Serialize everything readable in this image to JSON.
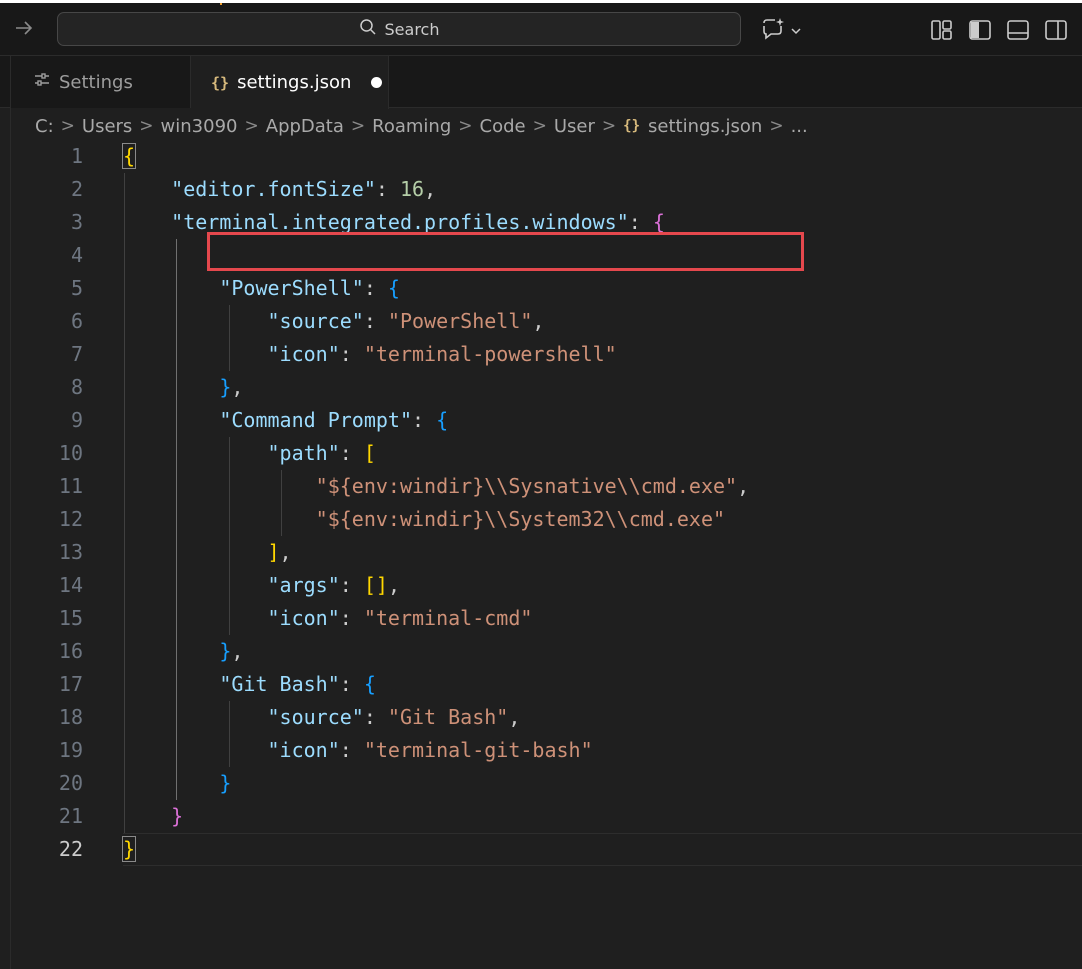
{
  "search": {
    "label": "Search"
  },
  "tabs": [
    {
      "label": "Settings",
      "icon": "settings-sliders-icon"
    },
    {
      "label": "settings.json",
      "icon": "json-braces-icon",
      "dirty": true
    }
  ],
  "breadcrumb": [
    "C:",
    "Users",
    "win3090",
    "AppData",
    "Roaming",
    "Code",
    "User",
    "settings.json",
    "..."
  ],
  "editor": {
    "active_line": "22",
    "line_numbers": [
      "1",
      "2",
      "3",
      "4",
      "5",
      "6",
      "7",
      "8",
      "9",
      "10",
      "11",
      "12",
      "13",
      "14",
      "15",
      "16",
      "17",
      "18",
      "19",
      "20",
      "21",
      "22"
    ],
    "lines": [
      [
        [
          "{",
          "b1"
        ]
      ],
      [
        [
          "    ",
          "p"
        ],
        [
          "\"editor.fontSize\"",
          "k"
        ],
        [
          ": ",
          "p"
        ],
        [
          "16",
          "n"
        ],
        [
          ",",
          "p"
        ]
      ],
      [
        [
          "    ",
          "p"
        ],
        [
          "\"terminal.integrated.profiles.windows\"",
          "k"
        ],
        [
          ": ",
          "p"
        ],
        [
          "{",
          "b2"
        ]
      ],
      [],
      [
        [
          "        ",
          "p"
        ],
        [
          "\"PowerShell\"",
          "k"
        ],
        [
          ": ",
          "p"
        ],
        [
          "{",
          "b3"
        ]
      ],
      [
        [
          "            ",
          "p"
        ],
        [
          "\"source\"",
          "k"
        ],
        [
          ": ",
          "p"
        ],
        [
          "\"PowerShell\"",
          "s"
        ],
        [
          ",",
          "p"
        ]
      ],
      [
        [
          "            ",
          "p"
        ],
        [
          "\"icon\"",
          "k"
        ],
        [
          ": ",
          "p"
        ],
        [
          "\"terminal-powershell\"",
          "s"
        ]
      ],
      [
        [
          "        ",
          "p"
        ],
        [
          "}",
          "b3"
        ],
        [
          ",",
          "p"
        ]
      ],
      [
        [
          "        ",
          "p"
        ],
        [
          "\"Command Prompt\"",
          "k"
        ],
        [
          ": ",
          "p"
        ],
        [
          "{",
          "b3"
        ]
      ],
      [
        [
          "            ",
          "p"
        ],
        [
          "\"path\"",
          "k"
        ],
        [
          ": ",
          "p"
        ],
        [
          "[",
          "b1"
        ]
      ],
      [
        [
          "                ",
          "p"
        ],
        [
          "\"${env:windir}\\\\Sysnative\\\\cmd.exe\"",
          "s"
        ],
        [
          ",",
          "p"
        ]
      ],
      [
        [
          "                ",
          "p"
        ],
        [
          "\"${env:windir}\\\\System32\\\\cmd.exe\"",
          "s"
        ]
      ],
      [
        [
          "            ",
          "p"
        ],
        [
          "]",
          "b1"
        ],
        [
          ",",
          "p"
        ]
      ],
      [
        [
          "            ",
          "p"
        ],
        [
          "\"args\"",
          "k"
        ],
        [
          ": ",
          "p"
        ],
        [
          "[]",
          "b1"
        ],
        [
          ",",
          "p"
        ]
      ],
      [
        [
          "            ",
          "p"
        ],
        [
          "\"icon\"",
          "k"
        ],
        [
          ": ",
          "p"
        ],
        [
          "\"terminal-cmd\"",
          "s"
        ]
      ],
      [
        [
          "        ",
          "p"
        ],
        [
          "}",
          "b3"
        ],
        [
          ",",
          "p"
        ]
      ],
      [
        [
          "        ",
          "p"
        ],
        [
          "\"Git Bash\"",
          "k"
        ],
        [
          ": ",
          "p"
        ],
        [
          "{",
          "b3"
        ]
      ],
      [
        [
          "            ",
          "p"
        ],
        [
          "\"source\"",
          "k"
        ],
        [
          ": ",
          "p"
        ],
        [
          "\"Git Bash\"",
          "s"
        ],
        [
          ",",
          "p"
        ]
      ],
      [
        [
          "            ",
          "p"
        ],
        [
          "\"icon\"",
          "k"
        ],
        [
          ": ",
          "p"
        ],
        [
          "\"terminal-git-bash\"",
          "s"
        ]
      ],
      [
        [
          "        ",
          "p"
        ],
        [
          "}",
          "b3"
        ]
      ],
      [
        [
          "    ",
          "p"
        ],
        [
          "}",
          "b2"
        ]
      ],
      [
        [
          "}",
          "b1"
        ]
      ]
    ]
  },
  "colors": {
    "background": "#1f1f1f",
    "titlebar": "#181818",
    "key": "#9cdcfe",
    "string": "#ce9178",
    "number": "#b5cea8",
    "bracket_gold": "#ffd700",
    "bracket_magenta": "#da70d6",
    "bracket_blue": "#179fff",
    "annotation_box": "#e5484d"
  }
}
